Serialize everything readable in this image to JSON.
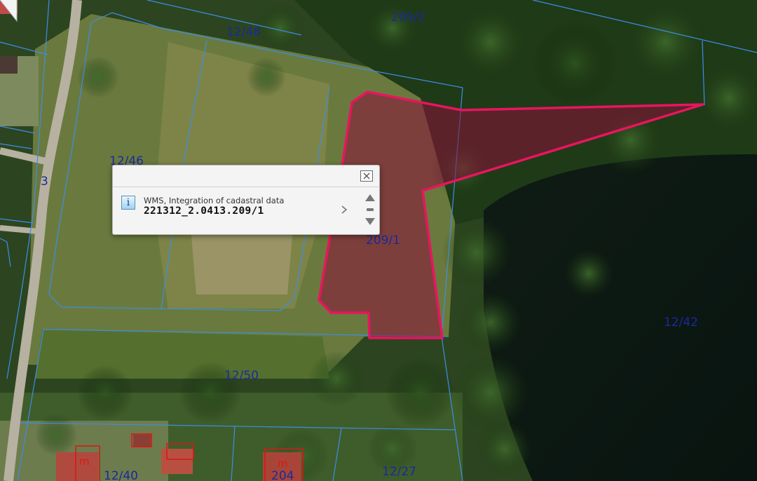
{
  "map": {
    "parcel_labels": [
      "12/48",
      "209/2",
      "12/46",
      "3",
      "209/1",
      "12/42",
      "12/50",
      "12/40",
      "204",
      "12/27"
    ],
    "building_marker": "m",
    "colors": {
      "parcel_boundary": "#3b8ee6",
      "selected_outline": "#e8155f",
      "selected_fill": "#8c0e3a",
      "parcel_label": "#1a2a9a",
      "building_outline": "#d81818"
    }
  },
  "popup": {
    "close_icon": "close-x-icon",
    "info_icon_glyph": "i",
    "layer_name": "WMS, Integration of cadastral data",
    "identifier": "221312_2.0413.209/1",
    "next_icon": "chevron-right-icon",
    "scroll_icons": [
      "arrow-up-icon",
      "minus-icon",
      "arrow-down-icon"
    ]
  }
}
